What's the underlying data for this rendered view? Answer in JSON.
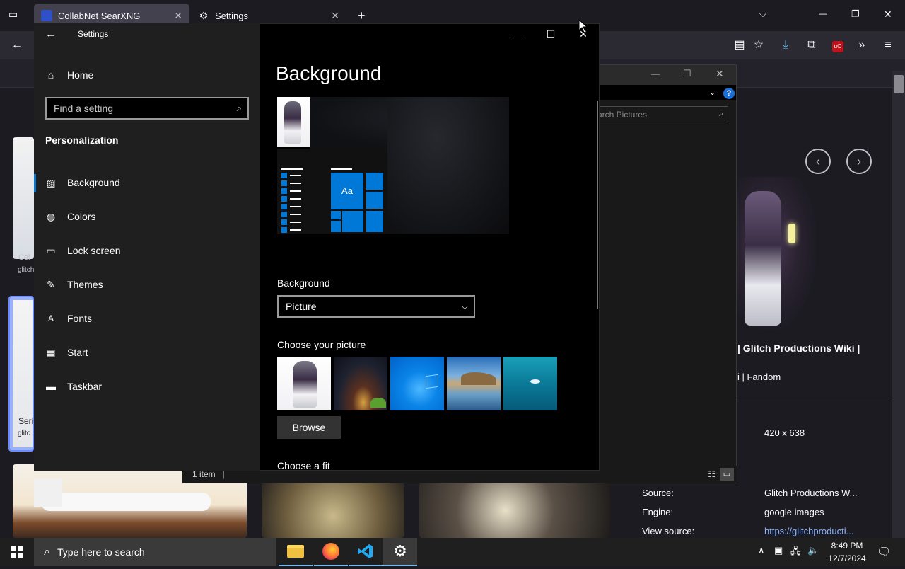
{
  "browser": {
    "tabs": [
      {
        "label": "CollabNet SearXNG",
        "close": "✕"
      },
      {
        "label": "Settings",
        "close": "✕"
      }
    ],
    "new_tab": "+",
    "window_controls": {
      "minimize": "—",
      "restore": "❐",
      "close": "✕"
    }
  },
  "page": {
    "detail_title": "| Glitch Productions Wiki |",
    "detail_subtitle": "i | Fandom",
    "dimensions": "420 x 638",
    "meta": [
      {
        "key": "Source:",
        "value": "Glitch Productions W..."
      },
      {
        "key": "Engine:",
        "value": "google images"
      },
      {
        "key": "View source:",
        "value": "https://glitchproducti..."
      }
    ],
    "side_labels": [
      "Cel",
      "glitch",
      "Seri",
      "glitc"
    ]
  },
  "explorer": {
    "search_placeholder": "arch Pictures",
    "status": "1 item",
    "status_sep": "|"
  },
  "settings": {
    "window_title": "Settings",
    "home": "Home",
    "search_placeholder": "Find a setting",
    "section": "Personalization",
    "nav": [
      {
        "label": "Background",
        "icon": "picture-icon"
      },
      {
        "label": "Colors",
        "icon": "palette-icon"
      },
      {
        "label": "Lock screen",
        "icon": "lock-screen-icon"
      },
      {
        "label": "Themes",
        "icon": "themes-icon"
      },
      {
        "label": "Fonts",
        "icon": "fonts-icon"
      },
      {
        "label": "Start",
        "icon": "start-icon"
      },
      {
        "label": "Taskbar",
        "icon": "taskbar-icon"
      }
    ],
    "page_title": "Background",
    "preview_tile": "Aa",
    "background_label": "Background",
    "background_value": "Picture",
    "choose_picture_label": "Choose your picture",
    "browse_label": "Browse",
    "choose_fit_label": "Choose a fit"
  },
  "taskbar": {
    "search_placeholder": "Type here to search",
    "time": "8:49 PM",
    "date": "12/7/2024"
  },
  "colors": {
    "accent": "#0078d7",
    "browser_bg": "#1c1b22",
    "settings_nav": "#1f1f1f"
  }
}
